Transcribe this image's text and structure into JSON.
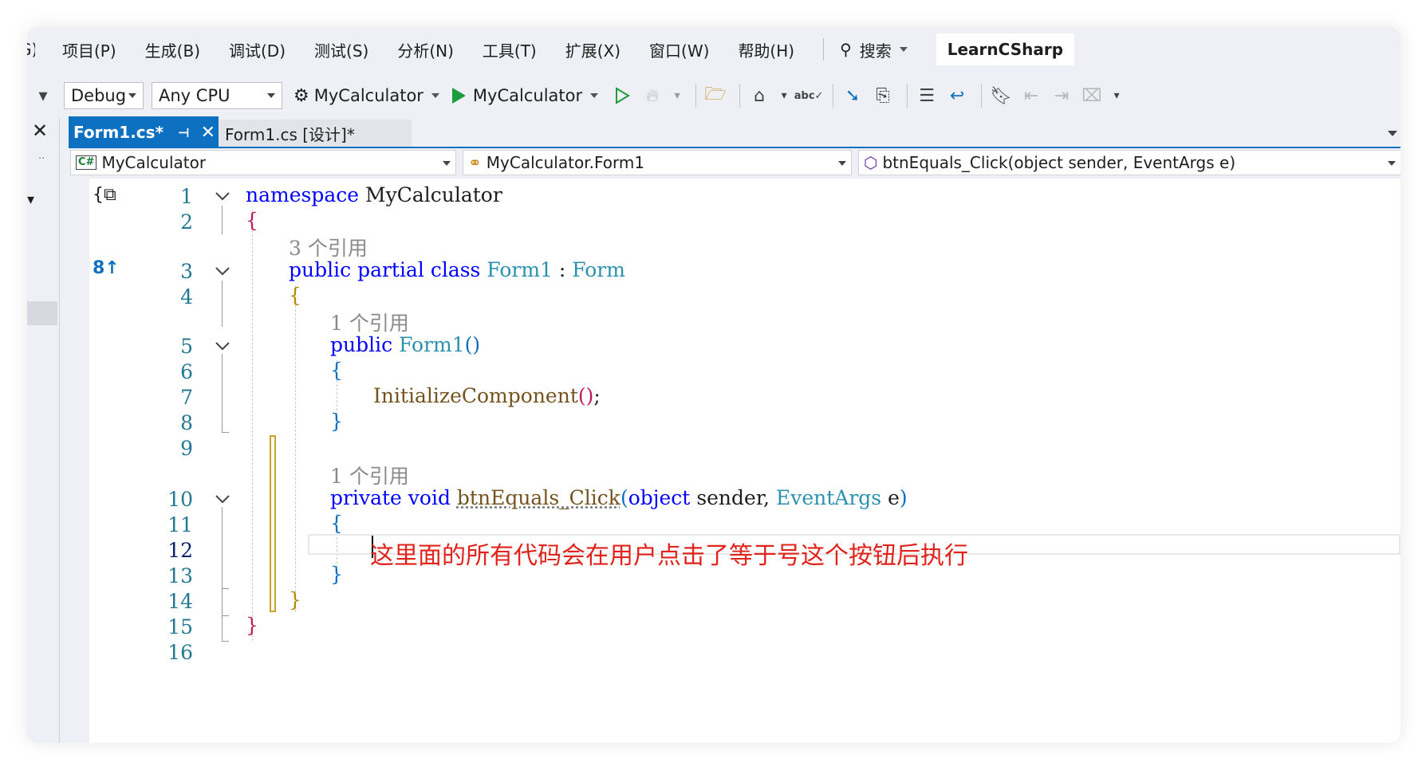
{
  "menu": {
    "cut_item": "G)",
    "items": [
      "项目(P)",
      "生成(B)",
      "调试(D)",
      "测试(S)",
      "分析(N)",
      "工具(T)",
      "扩展(X)",
      "窗口(W)",
      "帮助(H)"
    ],
    "search_label": "搜索",
    "solution_name": "LearnCSharp"
  },
  "toolbar": {
    "config": "Debug",
    "platform": "Any CPU",
    "startup_project": "MyCalculator",
    "start_label": "MyCalculator"
  },
  "tabs": {
    "active": "Form1.cs*",
    "second": "Form1.cs [设计]*"
  },
  "navbar": {
    "project": "MyCalculator",
    "project_icon": "C#",
    "class": "MyCalculator.Form1",
    "member": "btnEquals_Click(object sender, EventArgs e)"
  },
  "editor": {
    "line_numbers": [
      "1",
      "2",
      "3",
      "4",
      "5",
      "6",
      "7",
      "8",
      "9",
      "10",
      "11",
      "12",
      "13",
      "14",
      "15",
      "16"
    ],
    "current_line": "12",
    "lens": {
      "class_refs": "3 个引用",
      "ctor_refs": "1 个引用",
      "method_refs": "1 个引用"
    },
    "code": {
      "kw_namespace": "namespace",
      "ns_name": "MyCalculator",
      "open_brace": "{",
      "close_brace": "}",
      "kw_public": "public",
      "kw_partial": "partial",
      "kw_class": "class",
      "class_name": "Form1",
      "colon": ":",
      "base_type": "Form",
      "ctor_name": "Form1",
      "parens": "()",
      "init_call": "InitializeComponent",
      "semicolon": ";",
      "kw_private": "private",
      "kw_void": "void",
      "method_name": "btnEquals_Click",
      "lparen": "(",
      "kw_object": "object",
      "param1": "sender,",
      "param2_type": "EventArgs",
      "param2": "e",
      "rparen": ")"
    },
    "annotation": "这里面的所有代码会在用户点击了等于号这个按钮后执行"
  },
  "colors": {
    "keyword": "#0000ff",
    "type": "#2b91af",
    "method": "#74531f",
    "line_number": "#237893",
    "annotation": "#e0231c",
    "tab_active": "#0e70c0"
  }
}
